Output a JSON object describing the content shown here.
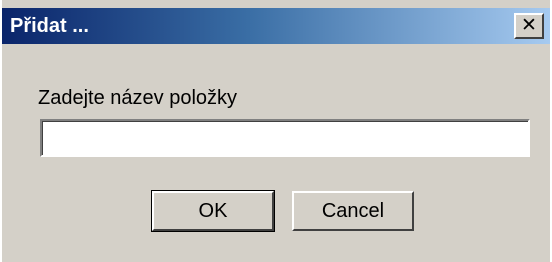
{
  "window": {
    "title": "Přidat ...",
    "close_icon": "close-icon",
    "close_glyph": "✕"
  },
  "form": {
    "prompt_label": "Zadejte název položky",
    "name_value": "",
    "name_placeholder": ""
  },
  "buttons": {
    "ok_label": "OK",
    "cancel_label": "Cancel"
  },
  "colors": {
    "dialog_background": "#d4d0c8",
    "titlebar_start": "#0a246a",
    "titlebar_end": "#a6caf0"
  }
}
